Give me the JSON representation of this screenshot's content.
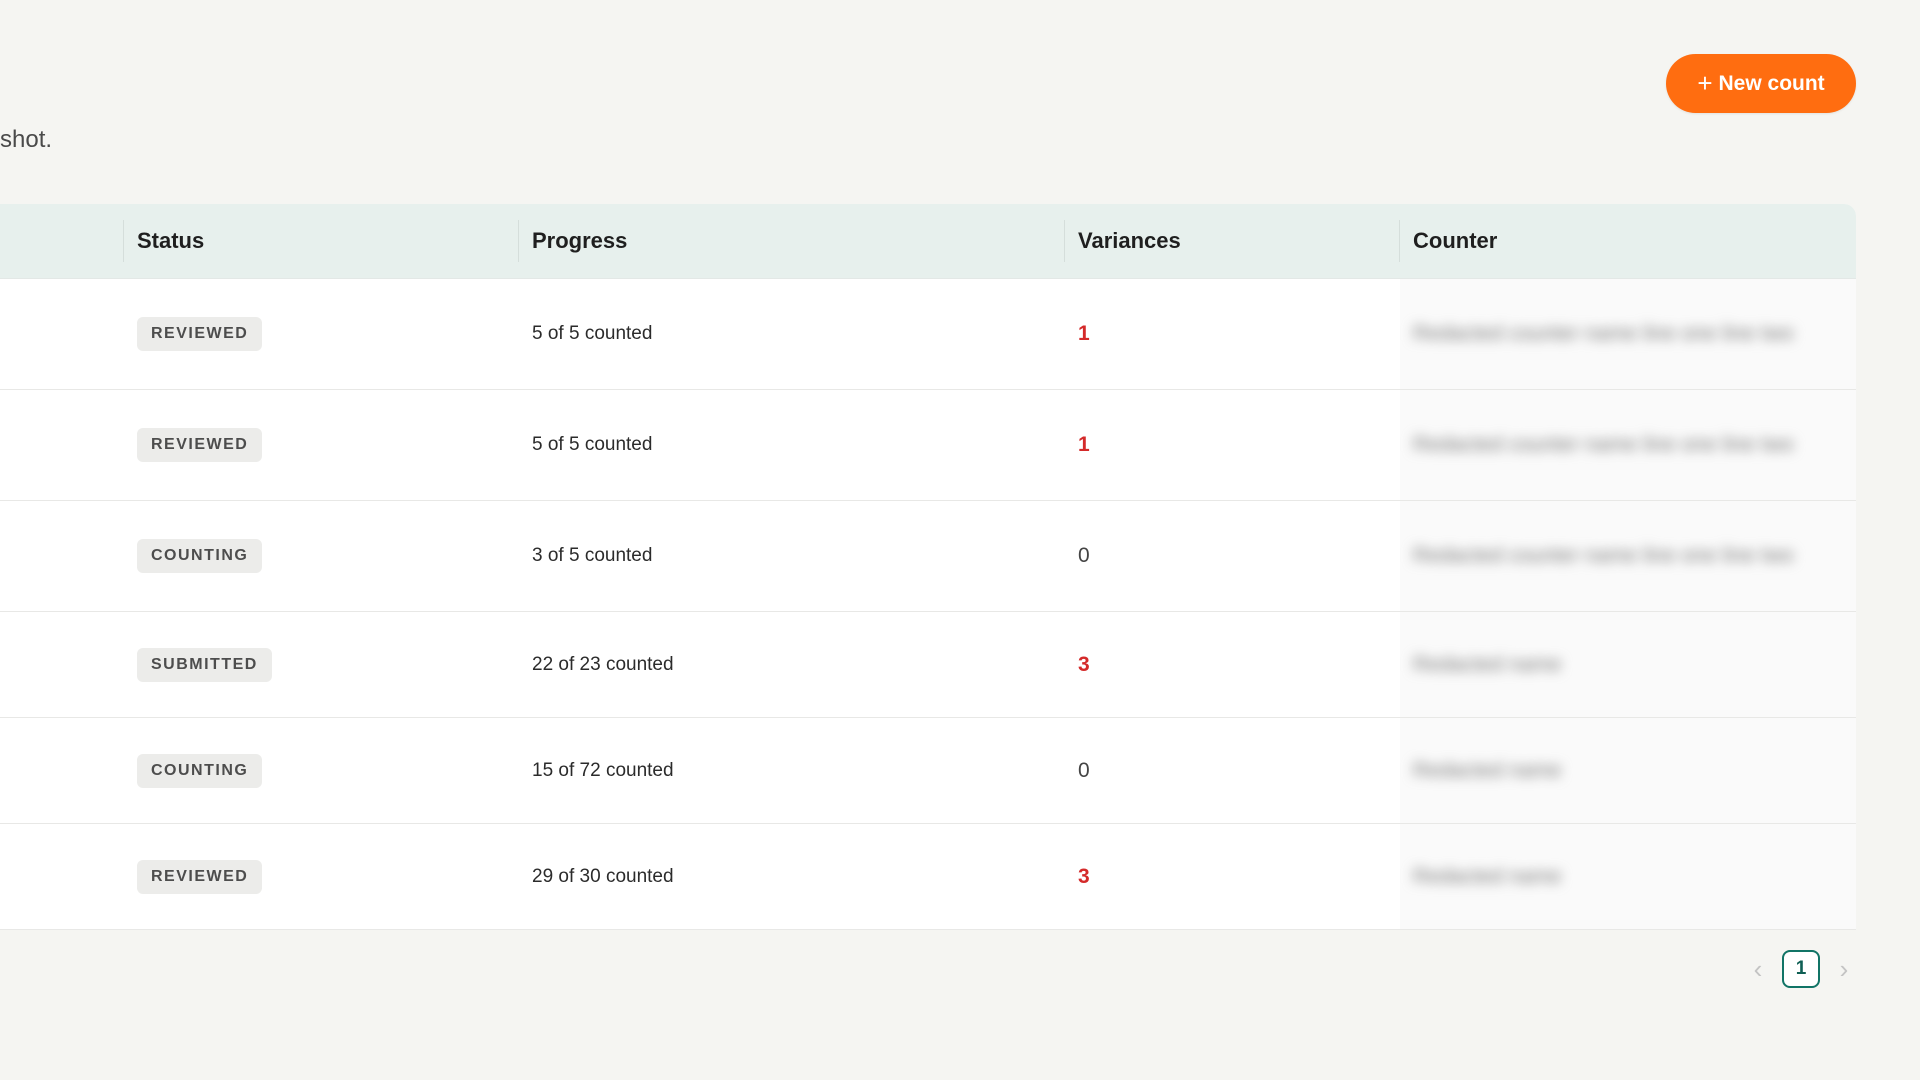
{
  "header": {
    "new_count_label": "New count",
    "subtitle": "shot."
  },
  "table": {
    "columns": {
      "status": "Status",
      "progress": "Progress",
      "variances": "Variances",
      "counter": "Counter"
    },
    "rows": [
      {
        "status": "REVIEWED",
        "progress": "5 of 5 counted",
        "variances": "1",
        "counter": "Redacted counter name line one line two"
      },
      {
        "status": "REVIEWED",
        "progress": "5 of 5 counted",
        "variances": "1",
        "counter": "Redacted counter name line one line two"
      },
      {
        "status": "COUNTING",
        "progress": "3 of 5 counted",
        "variances": "0",
        "counter": "Redacted counter name line one line two"
      },
      {
        "status": "SUBMITTED",
        "progress": "22 of 23 counted",
        "variances": "3",
        "counter": "Redacted name"
      },
      {
        "status": "COUNTING",
        "progress": "15 of 72 counted",
        "variances": "0",
        "counter": "Redacted name"
      },
      {
        "status": "REVIEWED",
        "progress": "29 of 30 counted",
        "variances": "3",
        "counter": "Redacted name"
      }
    ]
  },
  "pagination": {
    "current_page": "1",
    "prev_icon": "chevron-left-icon",
    "next_icon": "chevron-right-icon"
  },
  "colors": {
    "accent": "#ff6d10",
    "variance_alert": "#d42a2a",
    "page_active": "#117466",
    "header_bg": "#e7f0ed"
  }
}
